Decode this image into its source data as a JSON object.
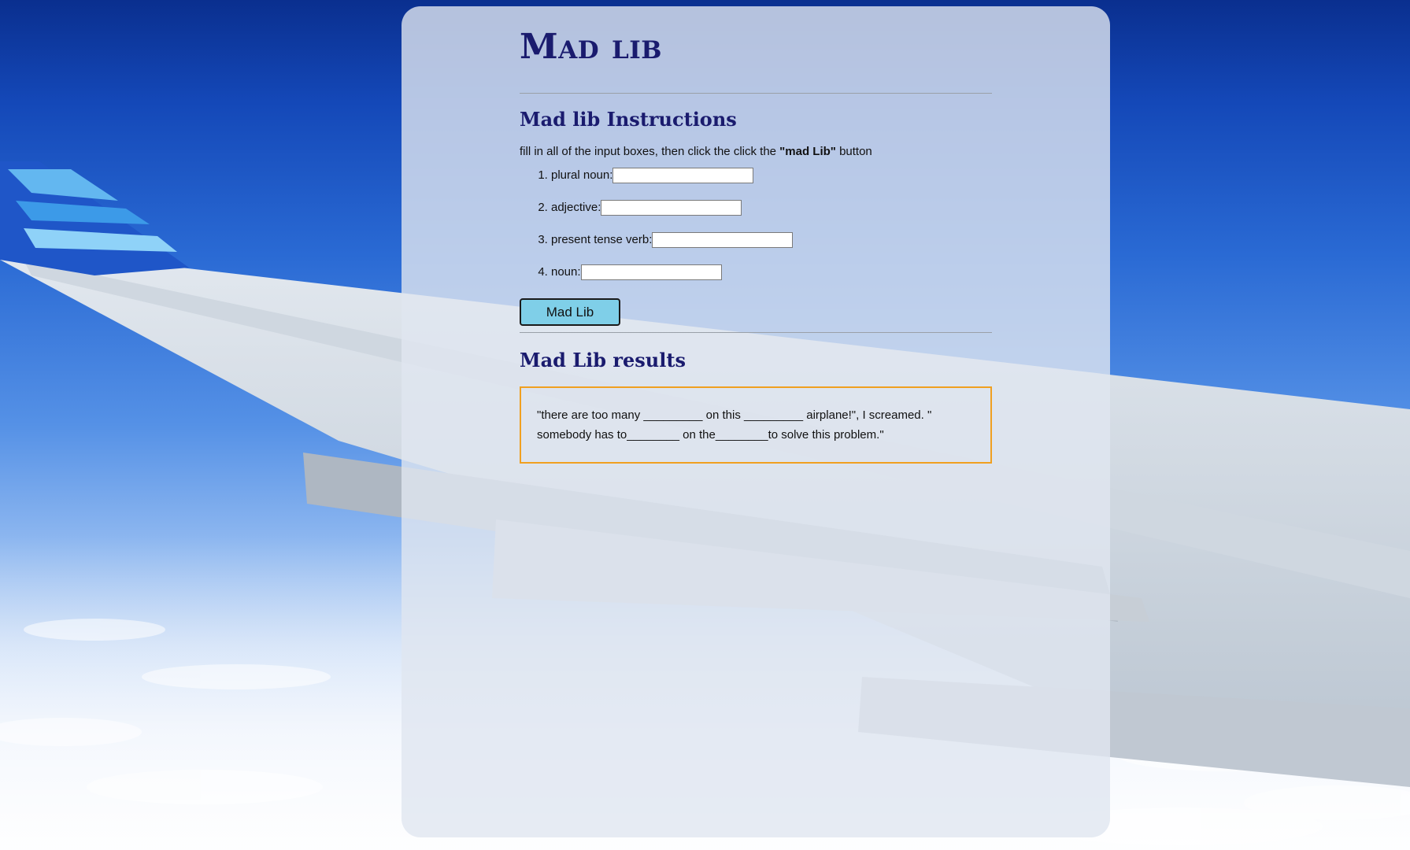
{
  "page": {
    "title": "Mad lib"
  },
  "instructions": {
    "heading": "Mad lib Instructions",
    "text_before": "fill in all of the input boxes, then click the click the ",
    "text_bold": "\"mad Lib\"",
    "text_after": " button"
  },
  "fields": [
    {
      "label": "plural noun:",
      "value": "",
      "placeholder": ""
    },
    {
      "label": "adjective:",
      "value": "",
      "placeholder": ""
    },
    {
      "label": "present tense verb:",
      "value": "",
      "placeholder": ""
    },
    {
      "label": "noun:",
      "value": "",
      "placeholder": ""
    }
  ],
  "button": {
    "label": "Mad Lib"
  },
  "results": {
    "heading": "Mad Lib results",
    "text": "\"there are too many _________ on this _________ airplane!\", I screamed. \" somebody has to________ on the________to solve this problem.\""
  },
  "colors": {
    "heading": "#1a1b6e",
    "button_bg": "#7fcfe8",
    "result_border": "#f0a020",
    "card_bg": "rgba(224, 230, 240, 0.80)"
  }
}
